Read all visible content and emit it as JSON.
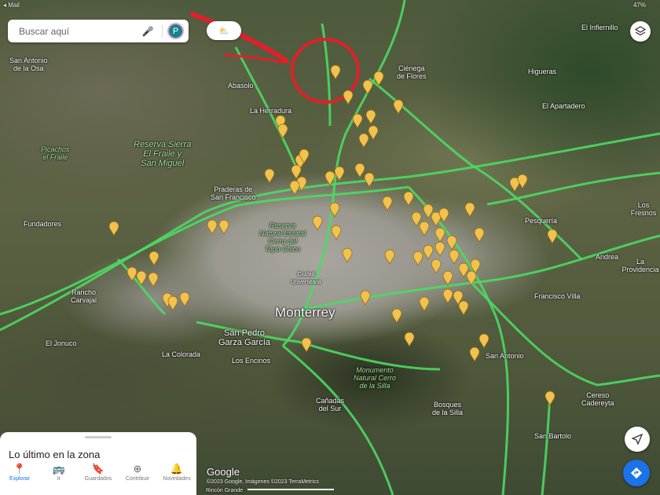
{
  "status_bar": {
    "left": "◂ Mail",
    "right": "47%"
  },
  "search": {
    "placeholder": "Buscar aquí",
    "avatar_letter": "P",
    "mic_icon": "microphone-icon"
  },
  "weather": {
    "icon": "partly-cloudy-icon",
    "label": "⛅"
  },
  "layers_icon": "layers-icon",
  "compass_icon": "navigation-arrow-icon",
  "directions_icon": "directions-icon",
  "map": {
    "labels": {
      "el_infiernillo": "El Infiernillo",
      "san_antonio_osa": "San Antonio\nde la Osa",
      "picachos": "Picachos\nel Fraile",
      "reserva_fraile": "Reserva Sierra\nEl Fraile y\nSan Miguel",
      "abasolo": "Abasolo",
      "herradura": "La Herradura",
      "cienega": "Ciénega\nde Flores",
      "higueras": "Higueras",
      "apartadero": "El Apartadero",
      "fundadores": "Fundadores",
      "praderas": "Praderas de\nSan Francisco",
      "topo_chico": "Reserva\nNatural Estatal\nCerro del\nTopo Chico",
      "ciudad_univ": "Ciudad\nUniversitaria",
      "pesqueria": "Pesquería",
      "los_fresnos": "Los Fresnos",
      "andrea": "Andrea",
      "providencia": "La Providencia",
      "francisco_villa": "Francisco Villa",
      "monterrey": "Monterrey",
      "san_pedro": "San Pedro\nGarza García",
      "rancho_carvajal": "Rancho\nCarvajal",
      "el_jonuco": "El Jonuco",
      "la_colorada": "La Colorada",
      "los_encinos": "Los Encinos",
      "cerro_silla": "Monumento\nNatural Cerro\nde la Silla",
      "canadas": "Cañadas\ndel Sur",
      "bosques": "Bosques\nde la Silla",
      "san_antonio": "San Antonio",
      "cadereyta": "Cereso\nCadereyta",
      "san_bartolo": "San Bartolo",
      "rincon": "Rincón Grande"
    },
    "attribution": {
      "logo": "Google",
      "copyright": "©2023 Google, Imágenes ©2023 TerraMetrics"
    }
  },
  "sheet": {
    "title": "Lo último en la zona"
  },
  "nav": [
    {
      "label": "Explorar",
      "icon": "📍"
    },
    {
      "label": "Ir",
      "icon": "🚌"
    },
    {
      "label": "Guardados",
      "icon": "🔖"
    },
    {
      "label": "Contribuir",
      "icon": "⊕"
    },
    {
      "label": "Novedades",
      "icon": "🔔"
    }
  ],
  "colors": {
    "traffic": "#4cd964",
    "pin": "#f2c14e",
    "annotation": "#e0202a",
    "accent": "#1a73e8"
  }
}
